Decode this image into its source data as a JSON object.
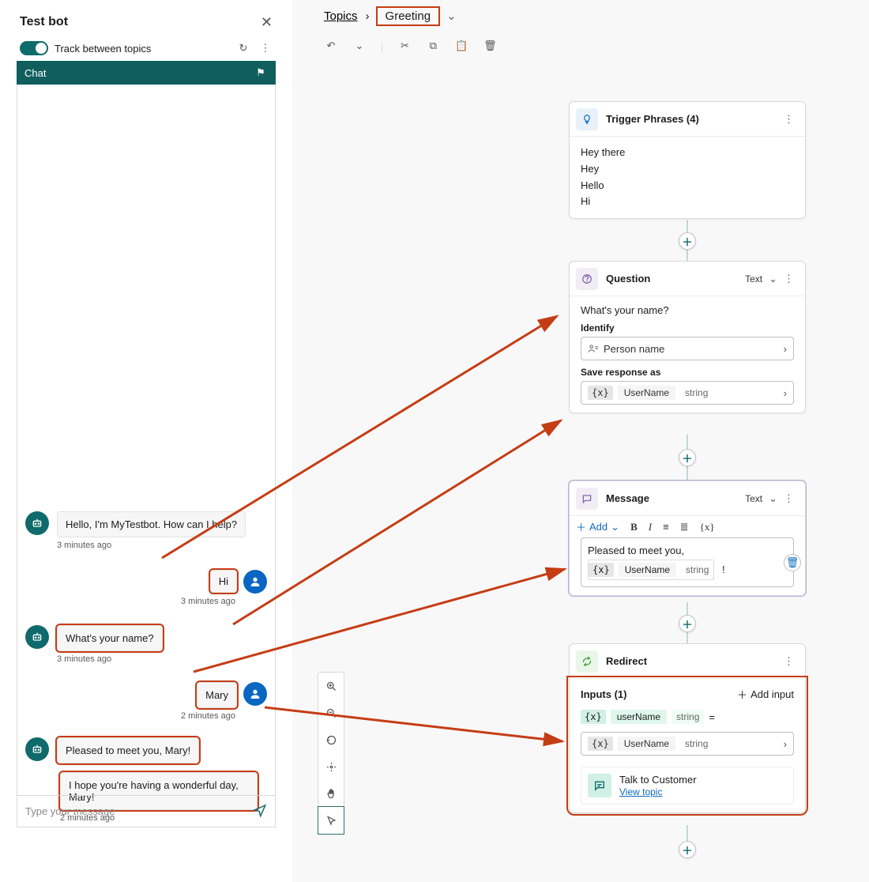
{
  "left": {
    "title": "Test bot",
    "track_label": "Track between topics",
    "chat_tab": "Chat",
    "compose_placeholder": "Type your message",
    "messages": [
      {
        "role": "bot",
        "text": "Hello, I'm MyTestbot. How can I help?",
        "ts": "3 minutes ago"
      },
      {
        "role": "user",
        "text": "Hi",
        "ts": "3 minutes ago"
      },
      {
        "role": "bot",
        "text": "What's your name?",
        "ts": "3 minutes ago"
      },
      {
        "role": "user",
        "text": "Mary",
        "ts": "2 minutes ago"
      },
      {
        "role": "bot",
        "text": "Pleased to meet you, Mary!",
        "ts": ""
      },
      {
        "role": "bot",
        "text": "I hope you're having a wonderful day, Mary!",
        "ts": "2 minutes ago"
      }
    ]
  },
  "breadcrumb": {
    "root": "Topics",
    "current": "Greeting"
  },
  "cards": {
    "trigger": {
      "title": "Trigger Phrases (4)",
      "phrases": [
        "Hey there",
        "Hey",
        "Hello",
        "Hi"
      ]
    },
    "question": {
      "title": "Question",
      "kind": "Text",
      "prompt": "What's your name?",
      "identify_label": "Identify",
      "identify_value": "Person name",
      "save_label": "Save response as",
      "var_name": "UserName",
      "var_type": "string"
    },
    "message": {
      "title": "Message",
      "kind": "Text",
      "add": "Add",
      "body": "Pleased to meet you,",
      "var_name": "UserName",
      "var_type": "string",
      "trailing": "!"
    },
    "redirect": {
      "title": "Redirect",
      "inputs_label": "Inputs (1)",
      "add_input": "Add input",
      "in_name": "userName",
      "in_type": "string",
      "val_name": "UserName",
      "val_type": "string",
      "target": "Talk to Customer",
      "view": "View topic"
    }
  }
}
